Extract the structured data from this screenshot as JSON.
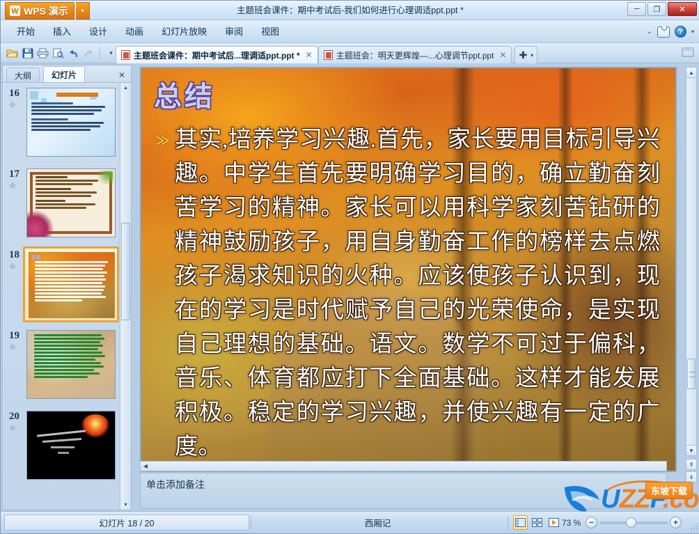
{
  "window": {
    "app_name": "WPS 演示",
    "app_badge": "W",
    "title": "主题班会课件：期中考试后-我们如何进行心理调适ppt.ppt *",
    "minimize": "─",
    "maximize": "❐",
    "close": "✕"
  },
  "menubar": {
    "items": [
      {
        "label": "开始"
      },
      {
        "label": "插入"
      },
      {
        "label": "设计"
      },
      {
        "label": "动画"
      },
      {
        "label": "幻灯片放映"
      },
      {
        "label": "审阅"
      },
      {
        "label": "视图"
      }
    ],
    "right": {
      "chevron": "⌄",
      "skin_icon": "skin-icon",
      "help_label": "?",
      "help_caret": "▾"
    }
  },
  "quick_access": {
    "buttons": [
      {
        "name": "open-icon",
        "tip": "打开"
      },
      {
        "name": "save-icon",
        "tip": "保存"
      },
      {
        "name": "print-icon",
        "tip": "打印"
      },
      {
        "name": "print-preview-icon",
        "tip": "打印预览"
      },
      {
        "name": "undo-icon",
        "tip": "撤销"
      },
      {
        "name": "redo-icon",
        "tip": "恢复"
      }
    ],
    "customize_caret": "▾"
  },
  "doc_tabs": {
    "tabs": [
      {
        "label": "主题班会课件：期中考试后...理调适ppt.ppt *",
        "close": "✕",
        "active": true
      },
      {
        "label": "主题班会：明天更辉煌—...心理调节ppt.ppt",
        "close": "✕",
        "active": false
      }
    ],
    "add_label": "✚",
    "add_caret": "▾"
  },
  "left_panel": {
    "tabs": [
      {
        "label": "大纲",
        "active": false
      },
      {
        "label": "幻灯片",
        "active": true
      }
    ],
    "close_label": "✕",
    "star_glyph": "☆",
    "slides": [
      {
        "number": "16",
        "theme": "blue",
        "selected": false
      },
      {
        "number": "17",
        "theme": "beige-frame",
        "selected": false
      },
      {
        "number": "18",
        "theme": "autumn",
        "selected": true
      },
      {
        "number": "19",
        "theme": "autumn-green-text",
        "selected": false
      },
      {
        "number": "20",
        "theme": "black-fireworks",
        "selected": false
      }
    ]
  },
  "slide": {
    "title": "总结",
    "bullet": "≫",
    "body": "其实,培养学习兴趣.首先，家长要用目标引导兴趣。中学生首先要明确学习目的，确立勤奋刻苦学习的精神。家长可以用科学家刻苦钻研的精神鼓励孩子，用自身勤奋工作的榜样去点燃孩子渴求知识的火种。应该使孩子认识到，现在的学习是时代赋予自己的光荣使命，是实现自己理想的基础。语文。数学不可过于偏科，音乐、体育都应打下全面基础。这样才能发展积极。稳定的学习兴趣，并使兴趣有一定的广度。"
  },
  "notes": {
    "placeholder": "单击添加备注"
  },
  "statusbar": {
    "slide_counter": "幻灯片 18 / 20",
    "theme_name": "西厢记",
    "views": [
      {
        "name": "normal-view-button",
        "active": true
      },
      {
        "name": "slide-sorter-view-button",
        "active": false
      },
      {
        "name": "slideshow-view-button",
        "active": false
      }
    ],
    "zoom_value": "73 %",
    "zoom_out": "−",
    "zoom_in": "+"
  },
  "watermark": {
    "text_u": "U",
    "text_zz": "ZZ",
    "text_f": "F",
    "text_dot_com": ".com",
    "badge": "东坡下载"
  },
  "colors": {
    "accent_orange": "#e8871b",
    "title_text": "#cfcdf0",
    "selection_border": "#e7a33c",
    "brand_blue": "#1a7fd4"
  }
}
